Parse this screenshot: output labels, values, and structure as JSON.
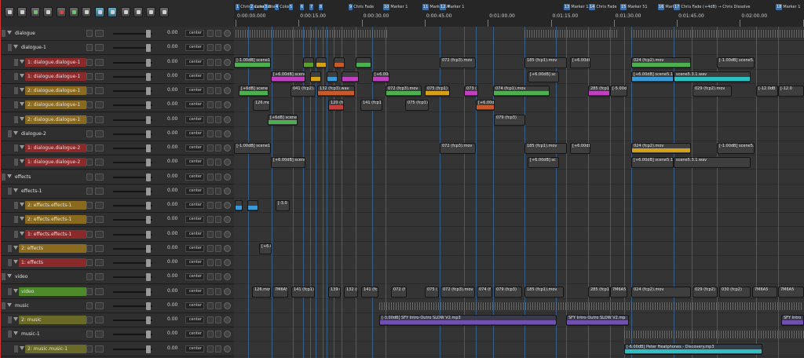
{
  "toolbar": {
    "buttons": [
      {
        "name": "new-project-icon",
        "tone": "plain"
      },
      {
        "name": "open-project-icon",
        "tone": "plain"
      },
      {
        "name": "save-project-icon",
        "tone": "green"
      },
      {
        "name": "project-settings-icon",
        "tone": "plain"
      },
      {
        "name": "undo-icon",
        "tone": "red"
      },
      {
        "name": "redo-icon",
        "tone": "green"
      },
      {
        "name": "metronome-icon",
        "tone": "plain"
      },
      {
        "name": "auto-crossfade-icon",
        "tone": "on"
      },
      {
        "name": "ripple-edit-icon",
        "tone": "on"
      },
      {
        "name": "snap-icon",
        "tone": "plain"
      },
      {
        "name": "grid-icon",
        "tone": "plain"
      },
      {
        "name": "envelope-lock-icon",
        "tone": "plain"
      },
      {
        "name": "lock-icon",
        "tone": "plain"
      }
    ]
  },
  "ruler": {
    "markers": [
      {
        "num": "1",
        "label": "Chris Laurence"
      },
      {
        "num": "2",
        "label": "Color Co"
      },
      {
        "num": "3",
        "label": "Ste"
      },
      {
        "num": "4",
        "label": "Color"
      },
      {
        "num": "5",
        "label": ""
      },
      {
        "num": "6",
        "label": ""
      },
      {
        "num": "7",
        "label": ""
      },
      {
        "num": "8",
        "label": ""
      },
      {
        "num": "9",
        "label": "Chris Fade"
      },
      {
        "num": "10",
        "label": "Marker 1"
      },
      {
        "num": "11",
        "label": "Marker 14"
      },
      {
        "num": "12",
        "label": "Marker 1"
      },
      {
        "num": "13",
        "label": "Marker 13"
      },
      {
        "num": "14",
        "label": "Chris Fade"
      },
      {
        "num": "15",
        "label": "Marker 51"
      },
      {
        "num": "16",
        "label": "Marker"
      },
      {
        "num": "17",
        "label": "Chris Fade (+4dB) → Chris Dissolve"
      },
      {
        "num": "18",
        "label": "Marker 1"
      }
    ],
    "times": [
      "0:00:00.000",
      "0:00:15.00",
      "0:00:30.00",
      "0:00:45.00",
      "0:01:00.00",
      "0:01:15.00",
      "0:01:30.00",
      "0:01:45.00",
      "0:02:00.00",
      "0:02:15.00"
    ]
  },
  "colors": {
    "red": "#8a2a2a",
    "orange": "#8a6a1f",
    "olive": "#6a6a28",
    "green": "#4e8a2a",
    "gray": "#3e3e3e",
    "marker_line": "#3a7fd0",
    "playhead": "#d33333"
  },
  "tracks": [
    {
      "label": "dialogue",
      "depth": 0,
      "color": "gray",
      "vol": "0.00",
      "pan": "center"
    },
    {
      "label": "dialogue-1",
      "depth": 1,
      "color": "gray",
      "vol": "0.00",
      "pan": "center"
    },
    {
      "label": "1: dialogue.dialogue-1",
      "depth": 2,
      "color": "red",
      "vol": "0.00",
      "pan": "center"
    },
    {
      "label": "1: dialogue.dialogue-1",
      "depth": 2,
      "color": "red",
      "vol": "0.00",
      "pan": "center"
    },
    {
      "label": "2: dialogue.dialogue-1",
      "depth": 2,
      "color": "orange",
      "vol": "0.00",
      "pan": "center"
    },
    {
      "label": "2: dialogue.dialogue-1",
      "depth": 2,
      "color": "orange",
      "vol": "0.00",
      "pan": "center"
    },
    {
      "label": "2: dialogue.dialogue-1",
      "depth": 2,
      "color": "orange",
      "vol": "0.00",
      "pan": "center"
    },
    {
      "label": "dialogue-2",
      "depth": 1,
      "color": "gray",
      "vol": "0.00",
      "pan": "center"
    },
    {
      "label": "1: dialogue.dialogue-2",
      "depth": 2,
      "color": "red",
      "vol": "0.00",
      "pan": "center"
    },
    {
      "label": "1: dialogue.dialogue-2",
      "depth": 2,
      "color": "red",
      "vol": "0.00",
      "pan": "center"
    },
    {
      "label": "effects",
      "depth": 0,
      "color": "gray",
      "vol": "0.00",
      "pan": "center"
    },
    {
      "label": "effects-1",
      "depth": 1,
      "color": "gray",
      "vol": "0.00",
      "pan": "center"
    },
    {
      "label": "2: effects.effects-1",
      "depth": 2,
      "color": "orange",
      "vol": "0.00",
      "pan": "center"
    },
    {
      "label": "2: effects.effects-1",
      "depth": 2,
      "color": "orange",
      "vol": "0.00",
      "pan": "center"
    },
    {
      "label": "1: effects.effects-1",
      "depth": 2,
      "color": "red",
      "vol": "0.00",
      "pan": "center"
    },
    {
      "label": "2: effects",
      "depth": 1,
      "color": "orange",
      "vol": "0.00",
      "pan": "center"
    },
    {
      "label": "1: effects",
      "depth": 1,
      "color": "red",
      "vol": "0.00",
      "pan": "center"
    },
    {
      "label": "video",
      "depth": 0,
      "color": "gray",
      "vol": "0.00",
      "pan": "center"
    },
    {
      "label": "video",
      "depth": 1,
      "color": "green",
      "vol": "0.00",
      "pan": "center"
    },
    {
      "label": "music",
      "depth": 0,
      "color": "gray",
      "vol": "0.00",
      "pan": "center"
    },
    {
      "label": "2: music",
      "depth": 1,
      "color": "olive",
      "vol": "0.00",
      "pan": "center"
    },
    {
      "label": "music-1",
      "depth": 1,
      "color": "gray",
      "vol": "0.00",
      "pan": "center"
    },
    {
      "label": "2: music.music-1",
      "depth": 2,
      "color": "olive",
      "vol": "0.00",
      "pan": "center"
    }
  ],
  "items": [
    {
      "track": 2,
      "text": "[-1.00dB] scene1",
      "color": "#3e3e3e",
      "start": 0.2,
      "len": 47,
      "wf": "#4caf50"
    },
    {
      "track": 2,
      "text": "",
      "color": "#3e3e3e",
      "start": 88,
      "len": 14,
      "wf": "#5aa02c"
    },
    {
      "track": 2,
      "text": "",
      "color": "#3e3e3e",
      "start": 104,
      "len": 14,
      "wf": "#d4a017"
    },
    {
      "track": 2,
      "text": "",
      "color": "#3e3e3e",
      "start": 127,
      "len": 14,
      "wf": "#c65a2a"
    },
    {
      "track": 2,
      "text": "",
      "color": "#3e3e3e",
      "start": 155,
      "len": 20,
      "wf": "#4caf50"
    },
    {
      "track": 2,
      "text": "072 (fcp3).mov",
      "color": "#3e3e3e",
      "start": 262,
      "len": 46,
      "wf": "#3e3e3e"
    },
    {
      "track": 2,
      "text": "185 (fcp1).mov",
      "color": "#3e3e3e",
      "start": 370,
      "len": 54,
      "wf": "#3e3e3e"
    },
    {
      "track": 2,
      "text": "[+6.00dB",
      "color": "#3e3e3e",
      "start": 428,
      "len": 26,
      "wf": "#3e3e3e"
    },
    {
      "track": 2,
      "text": "024 (fcp2).mov",
      "color": "#3e3e3e",
      "start": 506,
      "len": 76,
      "wf": "#4caf50"
    },
    {
      "track": 2,
      "text": "[-1.00dB] scene5.1",
      "color": "#3e3e3e",
      "start": 615,
      "len": 48,
      "wf": "#3e3e3e"
    },
    {
      "track": 3,
      "text": "[+6.00dB] scene",
      "color": "#3e3e3e",
      "start": 47,
      "len": 44,
      "wf": "#c040c0"
    },
    {
      "track": 3,
      "text": "",
      "color": "#3e3e3e",
      "start": 97,
      "len": 14,
      "wf": "#d4a017"
    },
    {
      "track": 3,
      "text": "",
      "color": "#3e3e3e",
      "start": 118,
      "len": 14,
      "wf": "#3a9ad8"
    },
    {
      "track": 3,
      "text": "",
      "color": "#3e3e3e",
      "start": 137,
      "len": 22,
      "wf": "#c040c0"
    },
    {
      "track": 3,
      "text": "[+6.00dB]",
      "color": "#3e3e3e",
      "start": 176,
      "len": 22,
      "wf": "#c040c0"
    },
    {
      "track": 3,
      "text": "[+6.00dB] sc",
      "color": "#3e3e3e",
      "start": 374,
      "len": 40,
      "wf": "#3e3e3e"
    },
    {
      "track": 3,
      "text": "[+6.00dB] scene5.1.1",
      "color": "#3e3e3e",
      "start": 506,
      "len": 54,
      "wf": "#3a9ad8"
    },
    {
      "track": 3,
      "text": "scene5.3.1.wav",
      "color": "#3e3e3e",
      "start": 560,
      "len": 98,
      "wf": "#2ec0c0"
    },
    {
      "track": 4,
      "text": "[+6dB] scene",
      "color": "#3e3e3e",
      "start": 6,
      "len": 38,
      "wf": "#4caf50"
    },
    {
      "track": 4,
      "text": "041 (fcp2).m",
      "color": "#3e3e3e",
      "start": 72,
      "len": 32,
      "wf": "#3e3e3e"
    },
    {
      "track": 4,
      "text": "132 (fcp3).wav",
      "color": "#3e3e3e",
      "start": 106,
      "len": 48,
      "wf": "#c65a2a"
    },
    {
      "track": 4,
      "text": "072 (fcp3).mov",
      "color": "#3e3e3e",
      "start": 193,
      "len": 46,
      "wf": "#4caf50"
    },
    {
      "track": 4,
      "text": "075 (fcp1)",
      "color": "#3e3e3e",
      "start": 243,
      "len": 32,
      "wf": "#d4a017"
    },
    {
      "track": 4,
      "text": "073 (",
      "color": "#3e3e3e",
      "start": 293,
      "len": 18,
      "wf": "#c040c0"
    },
    {
      "track": 4,
      "text": "074 (fcp1).mov",
      "color": "#3e3e3e",
      "start": 330,
      "len": 72,
      "wf": "#4caf50"
    },
    {
      "track": 4,
      "text": "285 (fcp1)",
      "color": "#3e3e3e",
      "start": 451,
      "len": 28,
      "wf": "#c040c0"
    },
    {
      "track": 4,
      "text": "[-5.00dB",
      "color": "#3e3e3e",
      "start": 479,
      "len": 22,
      "wf": "#3e3e3e"
    },
    {
      "track": 4,
      "text": "029 (fcp2).mov",
      "color": "#3e3e3e",
      "start": 584,
      "len": 50,
      "wf": "#3e3e3e"
    },
    {
      "track": 4,
      "text": "[-12.0dB",
      "color": "#3e3e3e",
      "start": 665,
      "len": 28,
      "wf": "#3e3e3e"
    },
    {
      "track": 4,
      "text": "[-12.0",
      "color": "#3e3e3e",
      "start": 693,
      "len": 33,
      "wf": "#3e3e3e"
    },
    {
      "track": 5,
      "text": "126.mov",
      "color": "#3e3e3e",
      "start": 24,
      "len": 22,
      "wf": "#3e3e3e"
    },
    {
      "track": 5,
      "text": "120 (fc",
      "color": "#3e3e3e",
      "start": 120,
      "len": 20,
      "wf": "#c04040"
    },
    {
      "track": 5,
      "text": "141 (fcp1)",
      "color": "#3e3e3e",
      "start": 161,
      "len": 28,
      "wf": "#3e3e3e"
    },
    {
      "track": 5,
      "text": "075 (fcp1)",
      "color": "#3e3e3e",
      "start": 218,
      "len": 30,
      "wf": "#3e3e3e"
    },
    {
      "track": 5,
      "text": "[+6.00d",
      "color": "#3e3e3e",
      "start": 308,
      "len": 24,
      "wf": "#c65a2a"
    },
    {
      "track": 6,
      "text": "[+6dB] scene",
      "color": "#3e3e3e",
      "start": 43,
      "len": 38,
      "wf": "#4caf50"
    },
    {
      "track": 6,
      "text": "079 (fcp3)",
      "color": "#3e3e3e",
      "start": 331,
      "len": 40,
      "wf": "#3e3e3e"
    },
    {
      "track": 8,
      "text": "[-1.00dB] scene1",
      "color": "#3e3e3e",
      "start": 0.2,
      "len": 47,
      "wf": "#3e3e3e"
    },
    {
      "track": 8,
      "text": "072 (fcp3).mov",
      "color": "#3e3e3e",
      "start": 262,
      "len": 46,
      "wf": "#3e3e3e"
    },
    {
      "track": 8,
      "text": "185 (fcp1).mov",
      "color": "#3e3e3e",
      "start": 370,
      "len": 54,
      "wf": "#3e3e3e"
    },
    {
      "track": 8,
      "text": "[+6.00dB",
      "color": "#3e3e3e",
      "start": 428,
      "len": 26,
      "wf": "#3e3e3e"
    },
    {
      "track": 8,
      "text": "024 (fcp2).mov",
      "color": "#3e3e3e",
      "start": 506,
      "len": 76,
      "wf": "#d4a017"
    },
    {
      "track": 8,
      "text": "[-1.00dB] scene5.1",
      "color": "#3e3e3e",
      "start": 615,
      "len": 48,
      "wf": "#3e3e3e"
    },
    {
      "track": 9,
      "text": "[+6.00dB] scene",
      "color": "#3e3e3e",
      "start": 47,
      "len": 44,
      "wf": "#3e3e3e"
    },
    {
      "track": 9,
      "text": "[+6.00dB] sc",
      "color": "#3e3e3e",
      "start": 374,
      "len": 40,
      "wf": "#3e3e3e"
    },
    {
      "track": 9,
      "text": "[+6.00dB] scene5.1.1",
      "color": "#3e3e3e",
      "start": 506,
      "len": 54,
      "wf": "#3e3e3e"
    },
    {
      "track": 9,
      "text": "scene5.3.1.wav",
      "color": "#3e3e3e",
      "start": 560,
      "len": 98,
      "wf": "#3e3e3e"
    },
    {
      "track": 12,
      "text": "",
      "color": "#3e3e3e",
      "start": 1,
      "len": 10,
      "wf": "#3a9ad8"
    },
    {
      "track": 12,
      "text": "",
      "color": "#3e3e3e",
      "start": 17,
      "len": 14,
      "wf": "#3a9ad8"
    },
    {
      "track": 12,
      "text": "[-3.0",
      "color": "#3e3e3e",
      "start": 53,
      "len": 18,
      "wf": "#3e3e3e"
    },
    {
      "track": 15,
      "text": "[+6.0",
      "color": "#3e3e3e",
      "start": 32,
      "len": 16,
      "wf": "#3e3e3e"
    },
    {
      "track": 18,
      "text": "126.mov",
      "color": "#3e3e3e",
      "start": 23,
      "len": 24,
      "wf": "#3e3e3e"
    },
    {
      "track": 18,
      "text": "7M6A5",
      "color": "#3e3e3e",
      "start": 49,
      "len": 20,
      "wf": "#3e3e3e"
    },
    {
      "track": 18,
      "text": "141 (fcp1)",
      "color": "#3e3e3e",
      "start": 73,
      "len": 30,
      "wf": "#3e3e3e"
    },
    {
      "track": 18,
      "text": "139 (",
      "color": "#3e3e3e",
      "start": 120,
      "len": 16,
      "wf": "#3e3e3e"
    },
    {
      "track": 18,
      "text": "132 (f",
      "color": "#3e3e3e",
      "start": 140,
      "len": 18,
      "wf": "#3e3e3e"
    },
    {
      "track": 18,
      "text": "141 (fc",
      "color": "#3e3e3e",
      "start": 162,
      "len": 22,
      "wf": "#3e3e3e"
    },
    {
      "track": 18,
      "text": "072 (f",
      "color": "#3e3e3e",
      "start": 200,
      "len": 20,
      "wf": "#3e3e3e"
    },
    {
      "track": 18,
      "text": "075 (",
      "color": "#3e3e3e",
      "start": 243,
      "len": 18,
      "wf": "#3e3e3e"
    },
    {
      "track": 18,
      "text": "072 (fcp3).mov",
      "color": "#3e3e3e",
      "start": 263,
      "len": 44,
      "wf": "#3e3e3e"
    },
    {
      "track": 18,
      "text": "074 (f",
      "color": "#3e3e3e",
      "start": 309,
      "len": 20,
      "wf": "#3e3e3e"
    },
    {
      "track": 18,
      "text": "079 (fcp3)",
      "color": "#3e3e3e",
      "start": 331,
      "len": 36,
      "wf": "#3e3e3e"
    },
    {
      "track": 18,
      "text": "185 (fcp1).mov",
      "color": "#3e3e3e",
      "start": 370,
      "len": 50,
      "wf": "#3e3e3e"
    },
    {
      "track": 18,
      "text": "285 (fcp1)",
      "color": "#3e3e3e",
      "start": 451,
      "len": 28,
      "wf": "#3e3e3e"
    },
    {
      "track": 18,
      "text": "7M6A5",
      "color": "#3e3e3e",
      "start": 479,
      "len": 22,
      "wf": "#3e3e3e"
    },
    {
      "track": 18,
      "text": "024 (fcp2).mov",
      "color": "#3e3e3e",
      "start": 506,
      "len": 76,
      "wf": "#3e3e3e"
    },
    {
      "track": 18,
      "text": "029 (fcp2)",
      "color": "#3e3e3e",
      "start": 584,
      "len": 32,
      "wf": "#3e3e3e"
    },
    {
      "track": 18,
      "text": "030 (fcp2)",
      "color": "#3e3e3e",
      "start": 618,
      "len": 40,
      "wf": "#3e3e3e"
    },
    {
      "track": 18,
      "text": "7M6A5",
      "color": "#3e3e3e",
      "start": 660,
      "len": 32,
      "wf": "#3e3e3e"
    },
    {
      "track": 18,
      "text": "7M6A5",
      "color": "#3e3e3e",
      "start": 693,
      "len": 33,
      "wf": "#3e3e3e"
    },
    {
      "track": 20,
      "text": "[-3.00dB] SFY Intro-Outro SLOW V2.mp3",
      "color": "#3a3a4a",
      "start": 185,
      "len": 226,
      "wf": "#7050b0"
    },
    {
      "track": 20,
      "text": "SFY Intro-Outro SLOW V2.mp",
      "color": "#3a3a4a",
      "start": 423,
      "len": 80,
      "wf": "#7050b0"
    },
    {
      "track": 20,
      "text": "SFY Intro",
      "color": "#3a3a4a",
      "start": 697,
      "len": 29,
      "wf": "#7050b0"
    },
    {
      "track": 22,
      "text": "[-6.00dB] Peter Heatphones - Discovery.mp3",
      "color": "#2e3e4a",
      "start": 497,
      "len": 176,
      "wf": "#2ec0c0"
    }
  ],
  "waves": [
    {
      "track": 0,
      "start": 2,
      "len": 195
    },
    {
      "track": 0,
      "start": 370,
      "len": 120
    },
    {
      "track": 0,
      "start": 506,
      "len": 220
    },
    {
      "track": 19,
      "start": 185,
      "len": 540
    },
    {
      "track": 21,
      "start": 497,
      "len": 229
    }
  ],
  "vlines": [
    18,
    48,
    75,
    88,
    97,
    104,
    113,
    118,
    127,
    137,
    155,
    176,
    193,
    262,
    293,
    308,
    330,
    370,
    410,
    423,
    451,
    479,
    497,
    506,
    560,
    583,
    615,
    665,
    693
  ]
}
